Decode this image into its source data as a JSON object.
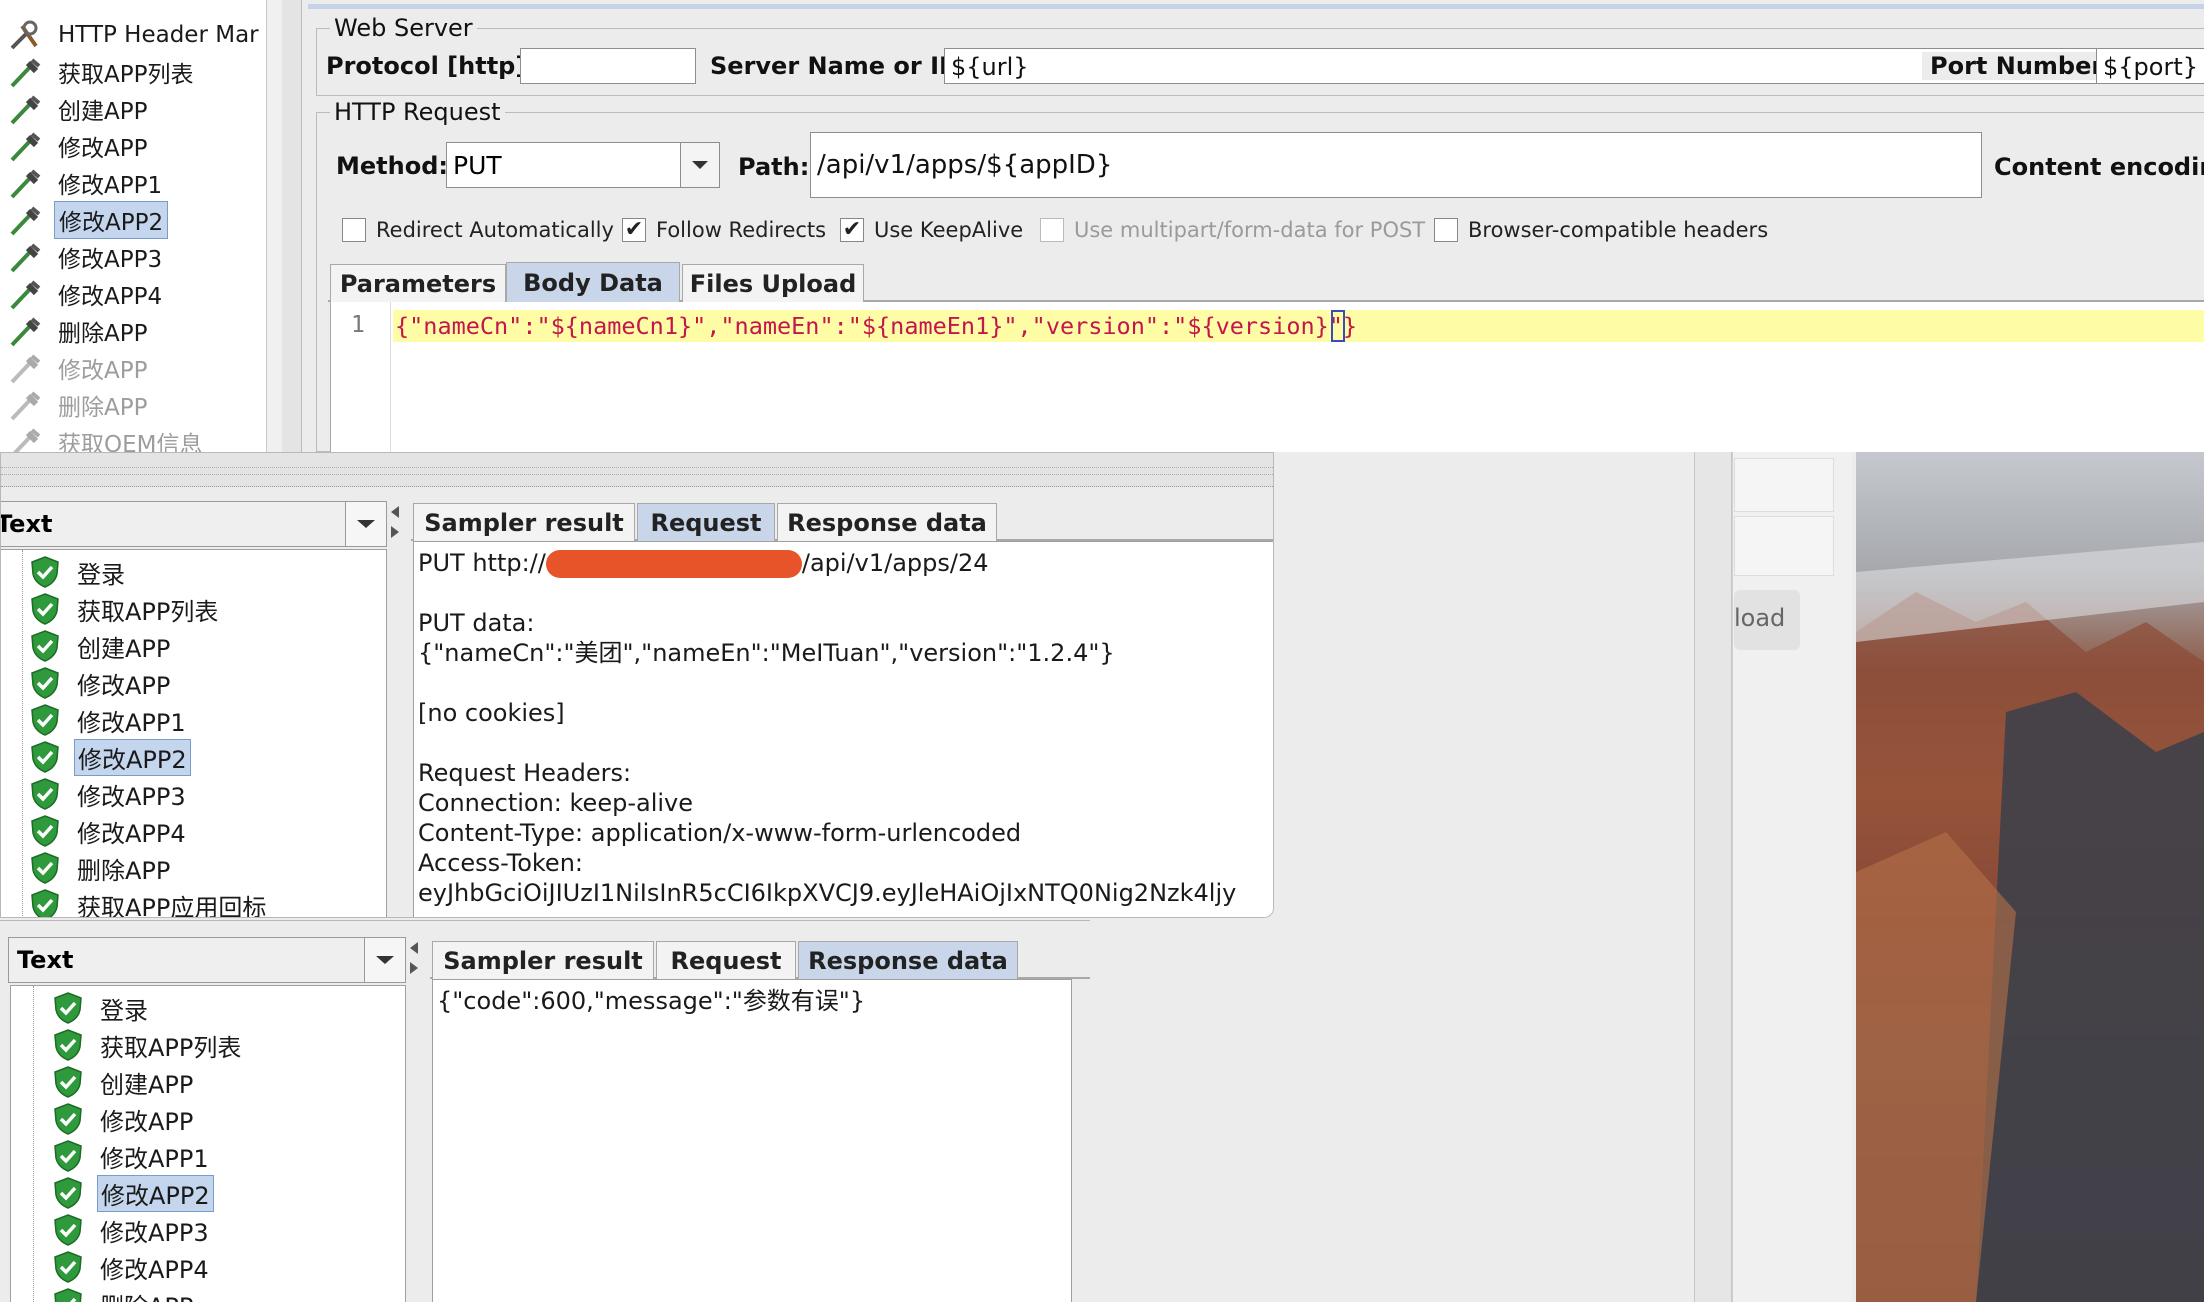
{
  "top_tree": {
    "items": [
      {
        "label": "HTTP Header Mar",
        "icon": "wrench-icon",
        "disabled": false
      },
      {
        "label": "获取APP列表",
        "icon": "pipette-icon",
        "disabled": false
      },
      {
        "label": "创建APP",
        "icon": "pipette-icon",
        "disabled": false
      },
      {
        "label": "修改APP",
        "icon": "pipette-icon",
        "disabled": false
      },
      {
        "label": "修改APP1",
        "icon": "pipette-icon",
        "disabled": false
      },
      {
        "label": "修改APP2",
        "icon": "pipette-icon",
        "disabled": false,
        "selected": true
      },
      {
        "label": "修改APP3",
        "icon": "pipette-icon",
        "disabled": false
      },
      {
        "label": "修改APP4",
        "icon": "pipette-icon",
        "disabled": false
      },
      {
        "label": "删除APP",
        "icon": "pipette-icon",
        "disabled": false
      },
      {
        "label": "修改APP",
        "icon": "pipette-icon",
        "disabled": true
      },
      {
        "label": "删除APP",
        "icon": "pipette-icon",
        "disabled": true
      },
      {
        "label": "获取OEM信息",
        "icon": "pipette-icon",
        "disabled": true
      }
    ]
  },
  "web_server": {
    "title": "Web Server",
    "protocol_label": "Protocol [http]:",
    "protocol_value": "",
    "server_label": "Server Name or IP:",
    "server_value": "${url}",
    "port_label": "Port Number:",
    "port_value": "${port}"
  },
  "http_request": {
    "title": "HTTP Request",
    "method_label": "Method:",
    "method_value": "PUT",
    "path_label": "Path:",
    "path_value": "/api/v1/apps/${appID}",
    "content_encoding_label": "Content encoding"
  },
  "options": [
    {
      "label": "Redirect Automatically",
      "checked": false,
      "disabled": false
    },
    {
      "label": "Follow Redirects",
      "checked": true,
      "disabled": false
    },
    {
      "label": "Use KeepAlive",
      "checked": true,
      "disabled": false
    },
    {
      "label": "Use multipart/form-data for POST",
      "checked": false,
      "disabled": true
    },
    {
      "label": "Browser-compatible headers",
      "checked": false,
      "disabled": false
    }
  ],
  "request_tabs": [
    "Parameters",
    "Body Data",
    "Files Upload"
  ],
  "request_active_tab": "Body Data",
  "body_editor": {
    "line_number": "1",
    "body_text": "{\"nameCn\":\"${nameCn1}\",\"nameEn\":\"${nameEn1}\",\"version\":\"${version}\"}"
  },
  "result_panel_1": {
    "renderer": "Text",
    "tabs": [
      "Sampler result",
      "Request",
      "Response data"
    ],
    "active_tab": "Request",
    "tree": [
      "登录",
      "获取APP列表",
      "创建APP",
      "修改APP",
      "修改APP1",
      "修改APP2",
      "修改APP3",
      "修改APP4",
      "删除APP",
      "获取APP应用回标"
    ],
    "selected": "修改APP2",
    "request_url_prefix": "PUT http://",
    "request_url_suffix": "/api/v1/apps/24",
    "put_data_label": "PUT data:",
    "put_data": "{\"nameCn\":\"美团\",\"nameEn\":\"MeITuan\",\"version\":\"1.2.4\"}",
    "cookies": "[no cookies]",
    "headers_label": "Request Headers:",
    "header_connection": "Connection: keep-alive",
    "header_content_type": "Content-Type: application/x-www-form-urlencoded",
    "header_access_token": "Access-Token:",
    "token_partial": "eyJhbGciOiJIUzI1NiIsInR5cCI6IkpXVCJ9.eyJleHAiOjIxNTQ0Nig2Nzk4ljy"
  },
  "result_panel_2": {
    "renderer": "Text",
    "tabs": [
      "Sampler result",
      "Request",
      "Response data"
    ],
    "active_tab": "Response data",
    "tree": [
      "登录",
      "获取APP列表",
      "创建APP",
      "修改APP",
      "修改APP1",
      "修改APP2",
      "修改APP3",
      "修改APP4",
      "删除APP"
    ],
    "selected": "修改APP2",
    "response": "{\"code\":600,\"message\":\"参数有误\"}"
  },
  "background_button_label": "load",
  "colors": {
    "selection": "#c4d6ee",
    "active_tab": "#c9d6ea",
    "editor_line": "#fefca4",
    "json_string": "#c4154d",
    "redaction": "#e8542a",
    "shield_green": "#2e9a3b"
  }
}
